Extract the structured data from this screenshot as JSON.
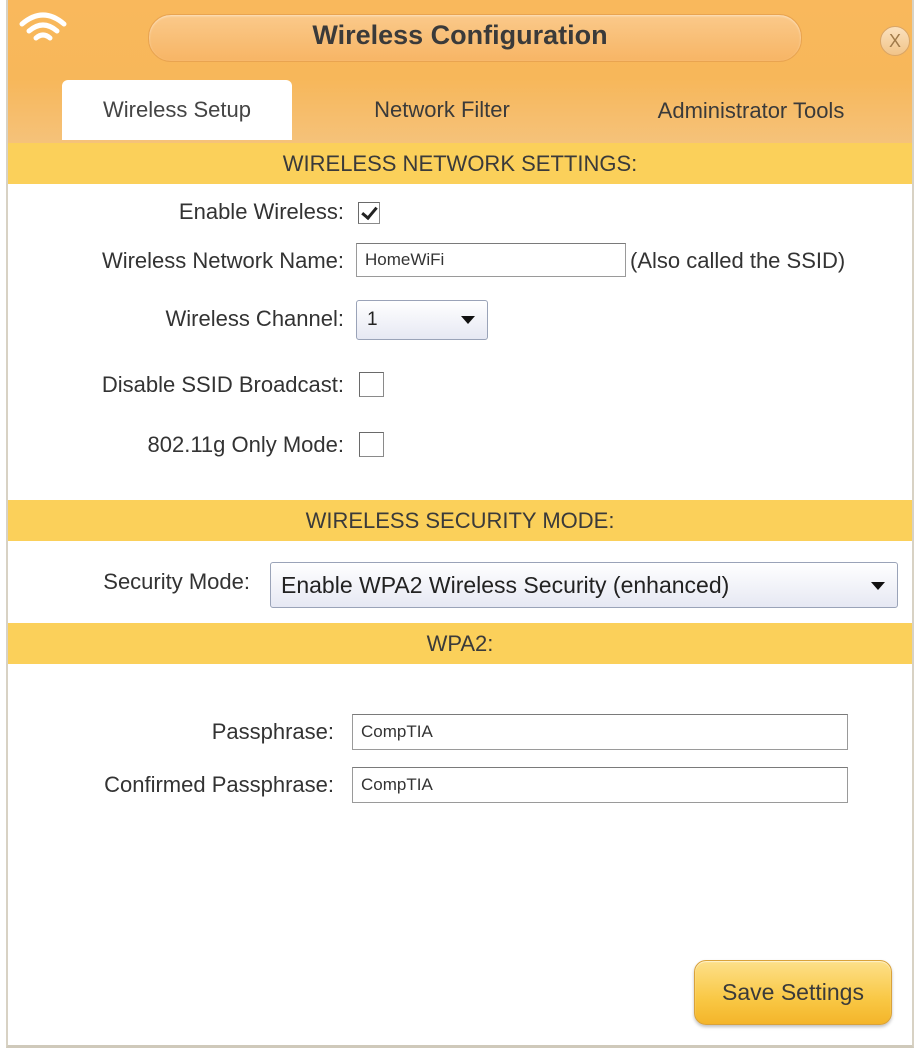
{
  "window": {
    "title": "Wireless Configuration",
    "close_label": "X"
  },
  "tabs": [
    {
      "label": "Wireless Setup",
      "active": true
    },
    {
      "label": "Network Filter",
      "active": false
    },
    {
      "label": "Administrator Tools",
      "active": false
    }
  ],
  "network_settings": {
    "heading": "WIRELESS NETWORK SETTINGS:",
    "enable_wireless_label": "Enable Wireless:",
    "enable_wireless_checked": true,
    "network_name_label": "Wireless Network Name:",
    "network_name_value": "HomeWiFi",
    "network_name_hint": "(Also called the SSID)",
    "channel_label": "Wireless Channel:",
    "channel_value": "1",
    "disable_ssid_label": "Disable SSID Broadcast:",
    "disable_ssid_checked": false,
    "g_only_label": "802.11g Only Mode:",
    "g_only_checked": false
  },
  "security": {
    "heading": "WIRELESS SECURITY MODE:",
    "mode_label": "Security Mode:",
    "mode_value": "Enable WPA2 Wireless Security (enhanced)"
  },
  "wpa2": {
    "heading": "WPA2:",
    "passphrase_label": "Passphrase:",
    "passphrase_value": "CompTIA",
    "confirm_label": "Confirmed Passphrase:",
    "confirm_value": "CompTIA"
  },
  "actions": {
    "save_label": "Save Settings"
  },
  "colors": {
    "header": "#f7b75a",
    "section_bar": "#fbd05a",
    "button": "#f9c845"
  }
}
